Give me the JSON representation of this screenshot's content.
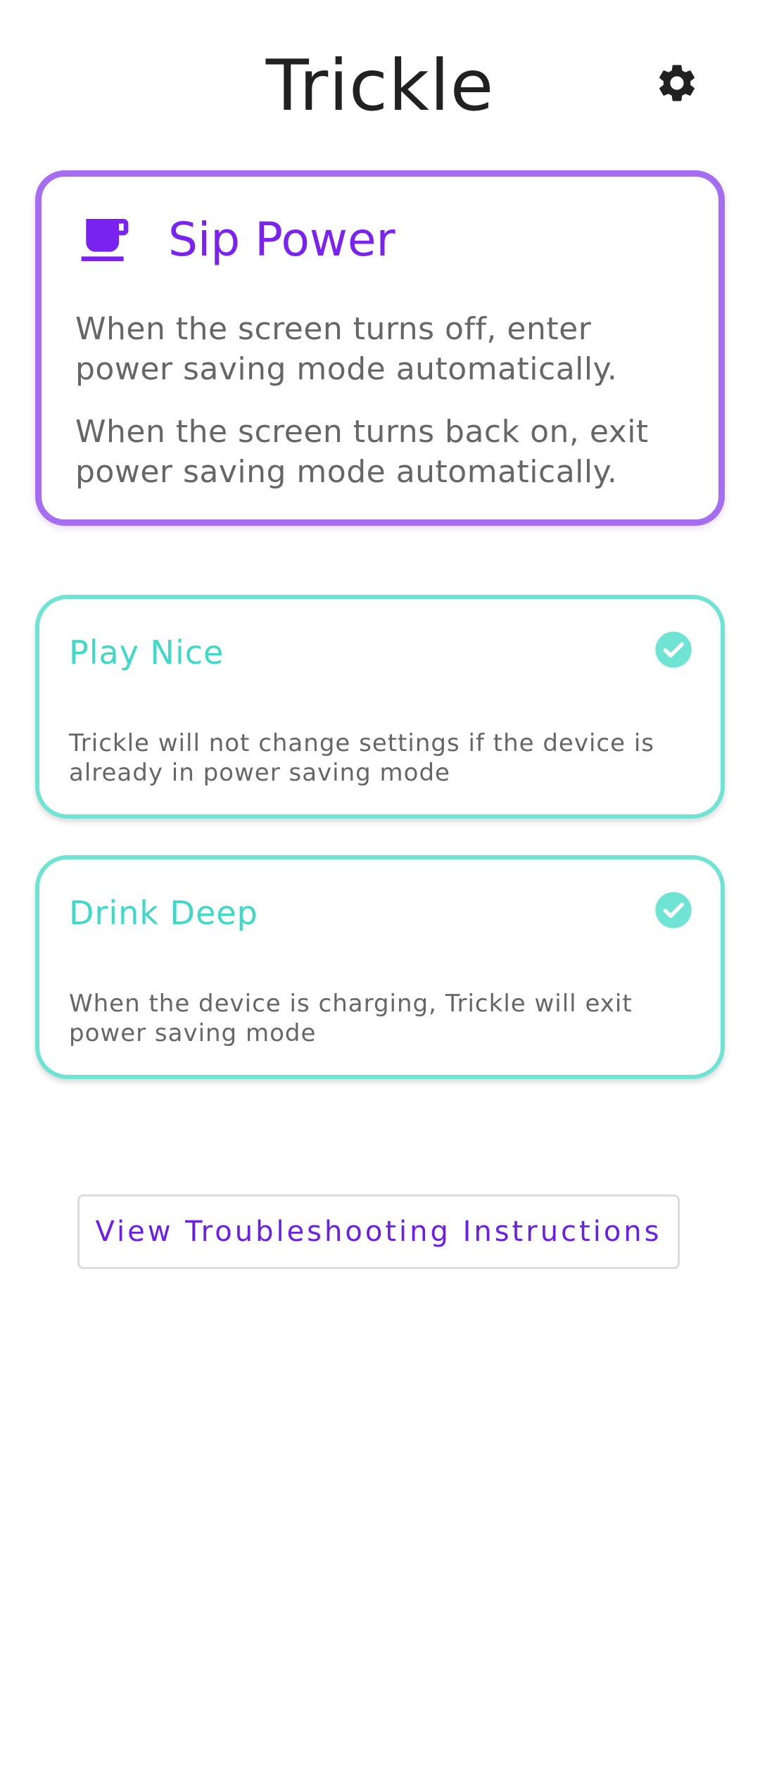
{
  "header": {
    "title": "Trickle",
    "settings_icon": "gear-icon"
  },
  "main_card": {
    "icon": "coffee-cup-icon",
    "title": "Sip Power",
    "description_1": "When the screen turns off, enter power saving mode automatically.",
    "description_2": "When the screen turns back on, exit power saving mode automatically.",
    "accent_color": "#a56df0",
    "title_color": "#7a22f0"
  },
  "options": [
    {
      "title": "Play Nice",
      "description": "Trickle will not change settings if the device is already in power saving mode",
      "checked": true,
      "icon": "check-circle-icon"
    },
    {
      "title": "Drink Deep",
      "description": "When the device is charging, Trickle will exit power saving mode",
      "checked": true,
      "icon": "check-circle-icon"
    }
  ],
  "options_accent_color": "#6fe3d4",
  "troubleshoot_button": {
    "label": "View Troubleshooting Instructions",
    "color": "#6a1fe8"
  }
}
